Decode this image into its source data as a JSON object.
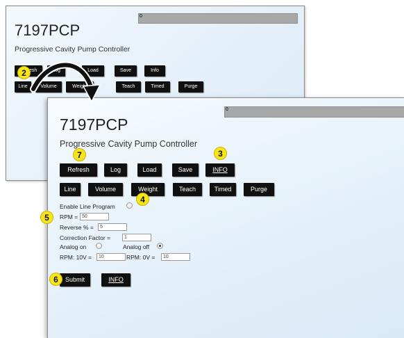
{
  "back_window": {
    "progress_value": "0",
    "title": "7197PCP",
    "subtitle": "Progressive Cavity Pump Controller",
    "row1": [
      "Refresh",
      "Log",
      "Load",
      "Save",
      "Info"
    ],
    "row2": [
      "Line",
      "Volume",
      "Weight",
      "Teach",
      "Timed",
      "Purge"
    ]
  },
  "front_window": {
    "progress_value": "0",
    "title": "7197PCP",
    "subtitle": "Progressive Cavity Pump Controller",
    "row1": [
      "Refresh",
      "Log",
      "Load",
      "Save",
      "INFO"
    ],
    "row2": [
      "Line",
      "Volume",
      "Weight",
      "Teach",
      "Timed",
      "Purge"
    ],
    "form": {
      "enable_label": "Enable Line Program",
      "enable_checked": false,
      "rpm_label": "RPM =",
      "rpm_value": "50",
      "reverse_label": "Reverse % =",
      "reverse_value": "5",
      "correction_label": "Correction Factor =",
      "correction_value": "1",
      "analog_on_label": "Analog on",
      "analog_on_checked": false,
      "analog_off_label": "Analog off",
      "analog_off_checked": true,
      "rpm10v_label": "RPM: 10V =",
      "rpm10v_value": "10",
      "rpm0v_label": "RPM: 0V =",
      "rpm0v_value": "10"
    },
    "submit_label": "Submit",
    "info_label": "INFO"
  },
  "callouts": {
    "c2": "2",
    "c3": "3",
    "c4": "4",
    "c5": "5",
    "c6": "6",
    "c7": "7"
  },
  "colors": {
    "button_bg": "#101010",
    "callout_yellow": "#f7e51a",
    "progress_gray": "#a8a8a8"
  },
  "icons": {
    "arrow": "curved-arrow-icon"
  }
}
